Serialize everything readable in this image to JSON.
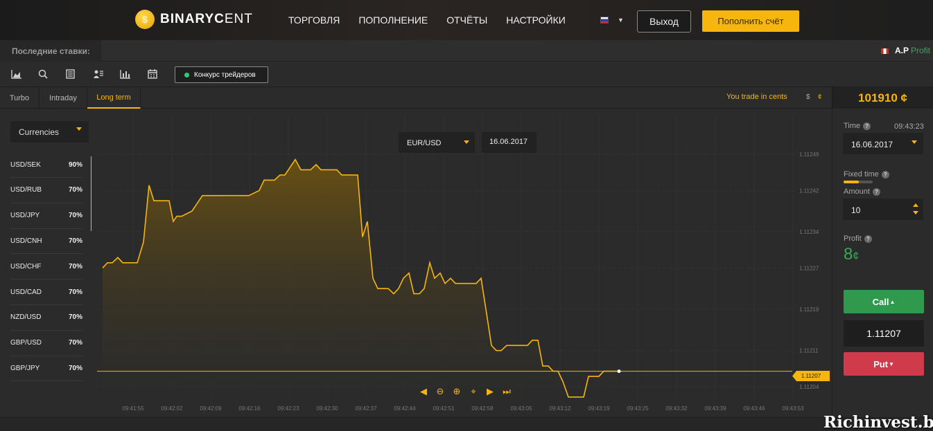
{
  "header": {
    "logo_main": "BINARYC",
    "logo_light": "ENT",
    "nav": [
      "ТОРГОВЛЯ",
      "ПОПОЛНЕНИЕ",
      "ОТЧЁТЫ",
      "НАСТРОЙКИ"
    ],
    "exit_label": "Выход",
    "deposit_label": "Пополнить счёт"
  },
  "last_bets": {
    "label": "Последние ставки:",
    "user_initials": "A.P",
    "user_profit": "Profit"
  },
  "toolbar": {
    "contest_label": "Конкурс трейдеров"
  },
  "tabs": [
    "Turbo",
    "Intraday",
    "Long term"
  ],
  "active_tab": "Long term",
  "trade_in_cents": "You trade in cents",
  "currency_usd": "$",
  "currency_cent": "¢",
  "balance": "101910 ¢",
  "assets": {
    "category": "Currencies",
    "items": [
      {
        "pair": "USD/SEK",
        "pct": "90%"
      },
      {
        "pair": "USD/RUB",
        "pct": "70%"
      },
      {
        "pair": "USD/JPY",
        "pct": "70%"
      },
      {
        "pair": "USD/CNH",
        "pct": "70%"
      },
      {
        "pair": "USD/CHF",
        "pct": "70%"
      },
      {
        "pair": "USD/CAD",
        "pct": "70%"
      },
      {
        "pair": "NZD/USD",
        "pct": "70%"
      },
      {
        "pair": "GBP/USD",
        "pct": "70%"
      },
      {
        "pair": "GBP/JPY",
        "pct": "70%"
      }
    ]
  },
  "chart": {
    "pair": "EUR/USD",
    "date": "16.06.2017",
    "current_price_tag": "1.11207"
  },
  "chart_data": {
    "type": "area",
    "y_ticks": [
      "1.11249",
      "1.11242",
      "1.11234",
      "1.11227",
      "1.11219",
      "1.11211",
      "1.11204"
    ],
    "x_ticks": [
      "09:41:55",
      "09:42:02",
      "09:42:09",
      "09:42:16",
      "09:42:23",
      "09:42:30",
      "09:42:37",
      "09:42:44",
      "09:42:51",
      "09:42:58",
      "09:43:05",
      "09:43:12",
      "09:43:19",
      "09:43:25",
      "09:43:32",
      "09:43:39",
      "09:43:46",
      "09:43:53"
    ],
    "ylim": [
      1.11204,
      1.11249
    ],
    "series": [
      {
        "t": [
          0,
          0.7,
          1.4,
          2.2,
          2.9,
          3.7,
          4.4,
          5.0,
          5.9,
          6.7,
          7.4,
          8.2,
          8.9,
          9.6,
          10.2,
          10.7,
          11.4,
          12.9,
          14.4,
          15.9,
          16.6,
          17.4,
          18.1,
          18.9,
          19.6,
          20.3,
          21.1,
          22.6,
          23.3,
          24.1,
          24.8,
          25.6,
          26.3,
          27.8,
          28.6,
          29.3,
          30.0,
          30.8,
          31.5,
          32.3,
          33.0,
          33.8,
          34.5,
          35.3,
          36.0,
          36.8,
          37.5,
          38.2,
          39.0,
          39.7,
          41.2,
          42.0,
          42.7,
          43.4,
          44.2,
          44.9,
          45.7,
          46.4,
          47.2,
          47.9,
          48.7,
          49.4,
          50.2,
          50.9,
          51.6,
          52.4,
          53.1,
          53.9,
          54.6,
          55.3,
          56.1,
          56.8,
          57.5,
          58.3,
          59.0,
          59.8,
          60.5,
          61.3,
          62.0,
          62.8,
          63.5,
          64.3,
          65.0,
          65.7,
          66.4,
          67.2,
          67.9,
          68.6,
          69.4,
          70.1,
          70.9,
          71.6,
          72.3,
          73.0,
          73.8,
          74.5
        ],
        "values": [
          1.11227,
          1.11228,
          1.11228,
          1.11229,
          1.11228,
          1.11228,
          1.11228,
          1.11228,
          1.11232,
          1.11243,
          1.1124,
          1.1124,
          1.1124,
          1.1124,
          1.11236,
          1.11237,
          1.11237,
          1.11238,
          1.11241,
          1.11241,
          1.11241,
          1.11241,
          1.11241,
          1.11241,
          1.11241,
          1.11241,
          1.11241,
          1.11242,
          1.11244,
          1.11244,
          1.11244,
          1.11245,
          1.11245,
          1.11248,
          1.11246,
          1.11246,
          1.11246,
          1.11247,
          1.11246,
          1.11246,
          1.11246,
          1.11246,
          1.11245,
          1.11245,
          1.11245,
          1.11245,
          1.11233,
          1.11236,
          1.11225,
          1.11223,
          1.11223,
          1.11222,
          1.11223,
          1.11225,
          1.11226,
          1.11222,
          1.11222,
          1.11223,
          1.11228,
          1.11225,
          1.11226,
          1.11224,
          1.11225,
          1.11224,
          1.11224,
          1.11224,
          1.11224,
          1.11224,
          1.11225,
          1.11219,
          1.11212,
          1.11211,
          1.11211,
          1.11212,
          1.11212,
          1.11212,
          1.11212,
          1.11212,
          1.11213,
          1.11213,
          1.11208,
          1.11208,
          1.11207,
          1.11207,
          1.11205,
          1.11202,
          1.11202,
          1.11202,
          1.11202,
          1.11206,
          1.11206,
          1.11206,
          1.11207,
          1.11207,
          1.11207,
          1.11207
        ]
      }
    ]
  },
  "right_panel": {
    "time_label": "Time",
    "time_value": "09:43:23",
    "date_value": "16.06.2017",
    "fixed_time_label": "Fixed time",
    "fixed_time_fill": 0.52,
    "amount_label": "Amount",
    "amount_value": "10",
    "profit_label": "Profit",
    "profit_value": "8",
    "profit_unit": "¢",
    "call_label": "Call",
    "current_price": "1.11207",
    "put_label": "Put"
  },
  "watermark": "Richinvest.biz",
  "colors": {
    "accent": "#f6b60e",
    "call": "#2f9a4d",
    "put": "#cf3b4b",
    "profit": "#38a859"
  }
}
